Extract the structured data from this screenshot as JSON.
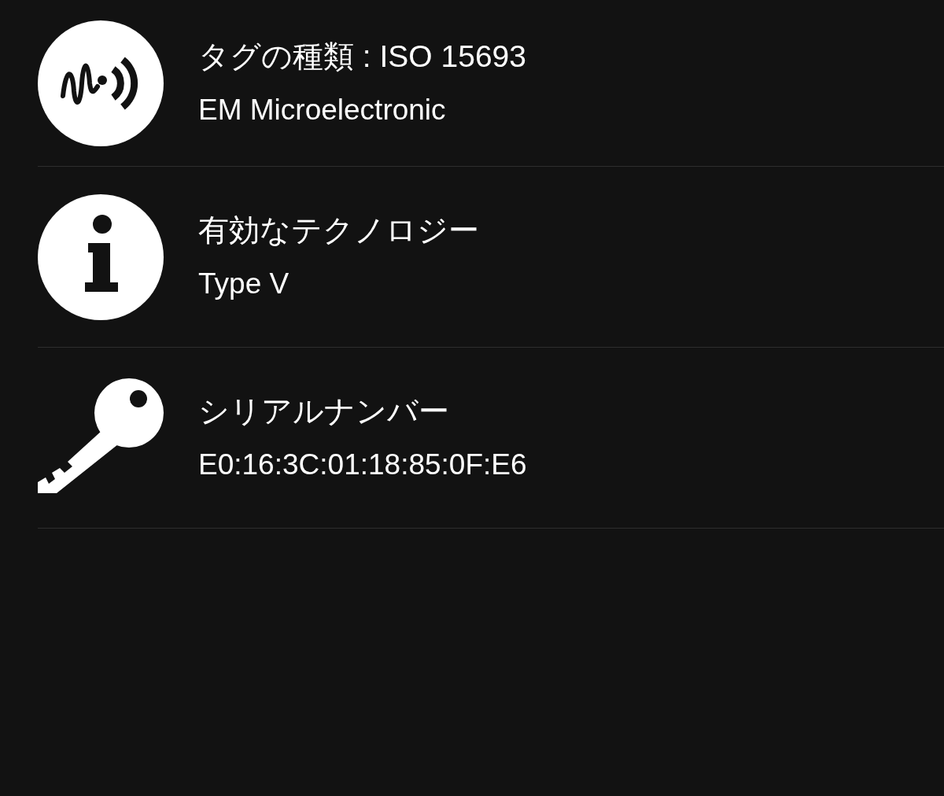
{
  "rows": [
    {
      "title": "タグの種類 : ISO 15693",
      "subtitle": "EM Microelectronic"
    },
    {
      "title": "有効なテクノロジー",
      "subtitle": "Type V"
    },
    {
      "title": "シリアルナンバー",
      "subtitle": "E0:16:3C:01:18:85:0F:E6"
    }
  ]
}
